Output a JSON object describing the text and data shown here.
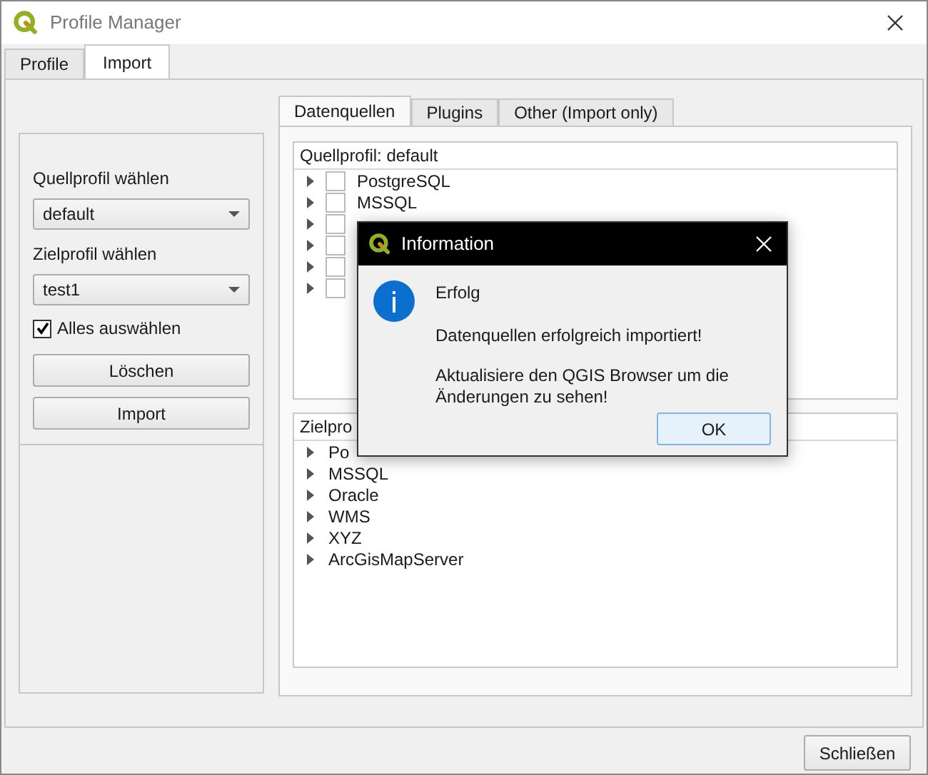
{
  "window": {
    "title": "Profile Manager"
  },
  "tabs": [
    {
      "label": "Profile",
      "selected": false
    },
    {
      "label": "Import",
      "selected": true
    }
  ],
  "left_panel": {
    "source_label": "Quellprofil wählen",
    "source_value": "default",
    "target_label": "Zielprofil wählen",
    "target_value": "test1",
    "select_all": {
      "label": "Alles auswählen",
      "checked": true
    },
    "buttons": [
      "Löschen",
      "Import"
    ]
  },
  "inner_tabs": [
    {
      "label": "Datenquellen",
      "selected": true
    },
    {
      "label": "Plugins",
      "selected": false
    },
    {
      "label": "Other (Import only)",
      "selected": false
    }
  ],
  "source_tree": {
    "header": "Quellprofil: default",
    "items": [
      {
        "label": "PostgreSQL",
        "checked": false
      },
      {
        "label": "MSSQL",
        "checked": false
      },
      {
        "checked": false
      },
      {
        "checked": false
      },
      {
        "checked": false
      },
      {
        "checked": false
      }
    ]
  },
  "target_tree": {
    "header": "Zielpro",
    "items": [
      "Po",
      "MSSQL",
      "Oracle",
      "WMS",
      "XYZ",
      "ArcGisMapServer"
    ]
  },
  "close_button": "Schließen",
  "dialog": {
    "title": "Information",
    "heading": "Erfolg",
    "message": "Datenquellen erfolgreich importiert!",
    "detail": "Aktualisiere den QGIS Browser um die Änderungen zu sehen!",
    "button": "OK"
  }
}
